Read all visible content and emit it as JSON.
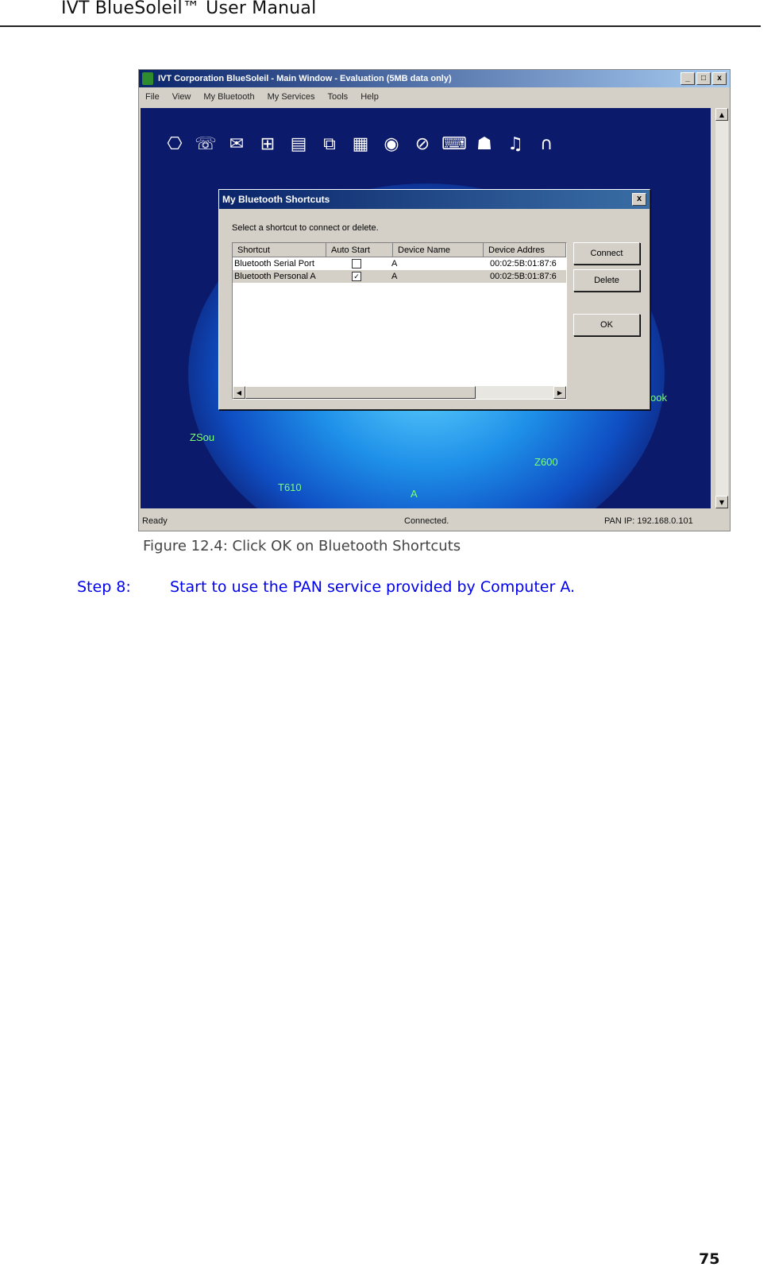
{
  "header": {
    "title": "IVT BlueSoleil™ User Manual"
  },
  "screenshot": {
    "window_title": "IVT Corporation BlueSoleil - Main Window - Evaluation (5MB data only)",
    "window_buttons": [
      "_",
      "□",
      "x"
    ],
    "menu": [
      "File",
      "View",
      "My Bluetooth",
      "My Services",
      "Tools",
      "Help"
    ],
    "service_icons": [
      "dialup-icon",
      "fax-icon",
      "file-transfer-icon",
      "network-icon",
      "object-push-icon",
      "sync-icon",
      "print-icon",
      "camera-icon",
      "mouse-icon",
      "keyboard-icon",
      "headset-icon",
      "audio-icon",
      "headphones-icon"
    ],
    "devices": {
      "zsou": "ZSou",
      "t610": "T610",
      "a": "A",
      "z600": "Z600",
      "book": "ook"
    },
    "status": {
      "left": "Ready",
      "middle": "Connected.",
      "right": "PAN IP: 192.168.0.101"
    },
    "dialog": {
      "title": "My Bluetooth Shortcuts",
      "close": "x",
      "prompt": "Select a shortcut to connect or delete.",
      "columns": [
        "Shortcut",
        "Auto Start",
        "Device Name",
        "Device Addres"
      ],
      "rows": [
        {
          "shortcut": "Bluetooth Serial Port",
          "auto": "",
          "device": "A",
          "address": "00:02:5B:01:87:6"
        },
        {
          "shortcut": "Bluetooth Personal A",
          "auto": "✓",
          "device": "A",
          "address": "00:02:5B:01:87:6"
        }
      ],
      "buttons": {
        "connect": "Connect",
        "delete": "Delete",
        "ok": "OK"
      }
    }
  },
  "caption": "Figure 12.4: Click OK on Bluetooth Shortcuts",
  "step": {
    "label": "Step 8:",
    "text": "Start to use the PAN service provided by Computer A."
  },
  "page_number": "75"
}
